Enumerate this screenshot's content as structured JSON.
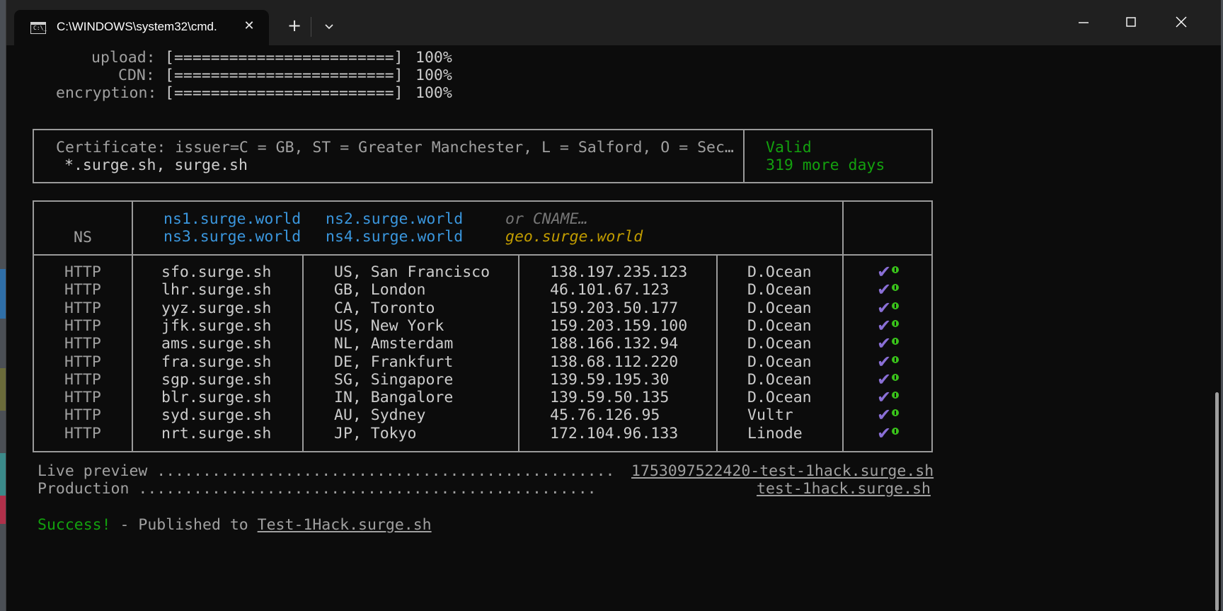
{
  "window": {
    "tab_title": "C:\\WINDOWS\\system32\\cmd.",
    "tab_icon_text": "C:\\_",
    "new_tab": "+"
  },
  "progress": [
    {
      "label": "upload:",
      "bar": "[========================]",
      "percent": "100%"
    },
    {
      "label": "CDN:",
      "bar": "[========================]",
      "percent": "100%"
    },
    {
      "label": "encryption:",
      "bar": "[========================]",
      "percent": "100%"
    }
  ],
  "certificate": {
    "line1": "Certificate: issuer=C = GB, ST = Greater Manchester, L = Salford, O = Sec…",
    "line2": "*.surge.sh, surge.sh",
    "status": "Valid",
    "remaining": "319 more days"
  },
  "ns": {
    "label": "NS",
    "servers": [
      "ns1.surge.world",
      "ns2.surge.world",
      "ns3.surge.world",
      "ns4.surge.world"
    ],
    "cname_hint": "or CNAME…",
    "cname": "geo.surge.world"
  },
  "edges": [
    {
      "proto": "HTTP",
      "host": "sfo.surge.sh",
      "location": "US, San Francisco",
      "ip": "138.197.235.123",
      "provider": "D.Ocean"
    },
    {
      "proto": "HTTP",
      "host": "lhr.surge.sh",
      "location": "GB, London",
      "ip": "46.101.67.123",
      "provider": "D.Ocean"
    },
    {
      "proto": "HTTP",
      "host": "yyz.surge.sh",
      "location": "CA, Toronto",
      "ip": "159.203.50.177",
      "provider": "D.Ocean"
    },
    {
      "proto": "HTTP",
      "host": "jfk.surge.sh",
      "location": "US, New York",
      "ip": "159.203.159.100",
      "provider": "D.Ocean"
    },
    {
      "proto": "HTTP",
      "host": "ams.surge.sh",
      "location": "NL, Amsterdam",
      "ip": "188.166.132.94",
      "provider": "D.Ocean"
    },
    {
      "proto": "HTTP",
      "host": "fra.surge.sh",
      "location": "DE, Frankfurt",
      "ip": "138.68.112.220",
      "provider": "D.Ocean"
    },
    {
      "proto": "HTTP",
      "host": "sgp.surge.sh",
      "location": "SG, Singapore",
      "ip": "139.59.195.30",
      "provider": "D.Ocean"
    },
    {
      "proto": "HTTP",
      "host": "blr.surge.sh",
      "location": "IN, Bangalore",
      "ip": "139.59.50.135",
      "provider": "D.Ocean"
    },
    {
      "proto": "HTTP",
      "host": "syd.surge.sh",
      "location": "AU, Sydney",
      "ip": "45.76.126.95",
      "provider": "Vultr"
    },
    {
      "proto": "HTTP",
      "host": "nrt.surge.sh",
      "location": "JP, Tokyo",
      "ip": "172.104.96.133",
      "provider": "Linode"
    }
  ],
  "preview": {
    "label": "Live preview",
    "dots": "..................................................",
    "url": "1753097522420-test-1hack.surge.sh"
  },
  "production": {
    "label": "Production",
    "dots": "..................................................",
    "url": "test-1hack.surge.sh"
  },
  "success": {
    "word": "Success!",
    "message": " - Published to ",
    "url": "Test-1Hack.surge.sh"
  },
  "colors": {
    "background": "#0c0c0c",
    "titlebar": "#202020",
    "text": "#cccccc",
    "green": "#13a10e",
    "blue": "#3a96dd",
    "gold": "#c19c00",
    "check_purple": "#8a6fd6"
  }
}
